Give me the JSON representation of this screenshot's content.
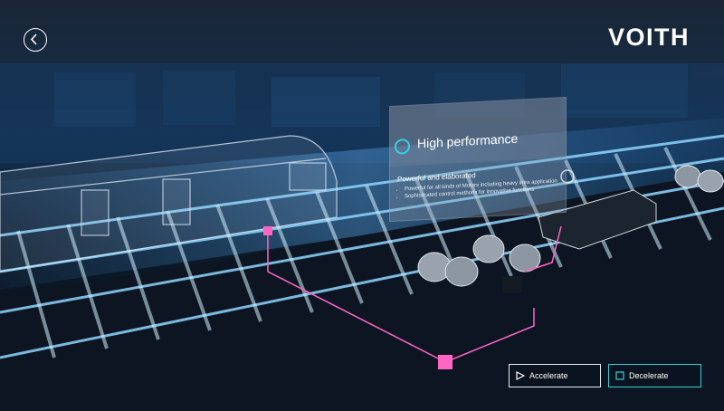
{
  "brand": {
    "logo_text": "VOITH"
  },
  "nav": {
    "back_icon": "chevron-left-icon"
  },
  "info_panel": {
    "icon": "ring-icon",
    "title": "High performance",
    "subtitle": "Powerful and elaborated",
    "bullets": [
      "Powerful for all kinds of Motors including heavy intra application",
      "Sophisticated control methods for innovative functions"
    ]
  },
  "controls": {
    "accelerate_label": "Accelerate",
    "accelerate_icon": "play-icon",
    "decelerate_label": "Decelerate",
    "decelerate_icon": "stop-square-icon"
  },
  "colors": {
    "accent_cyan": "#2fd4d8",
    "highlight_pink": "#ff66c4",
    "background": "#0b1420"
  }
}
